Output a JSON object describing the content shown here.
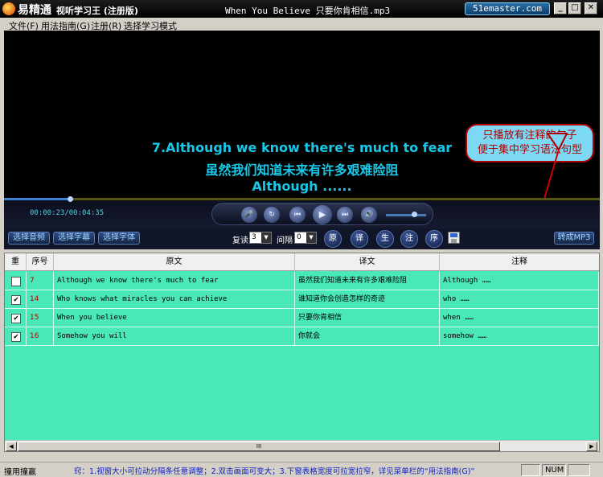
{
  "titlebar": {
    "app_name": "易精通",
    "app_subtitle": "视听学习王 (注册版)",
    "window_title": "When You Believe 只要你肯相信.mp3",
    "site_badge": "51emaster.com",
    "minimize": "_",
    "maximize": "□",
    "close": "✕"
  },
  "menu": {
    "items": [
      "文件(F)",
      "用法指南(G)",
      "注册(R)",
      "选择学习模式"
    ]
  },
  "video": {
    "subtitle_en": "7.Although we know there's much to fear",
    "subtitle_cn": "虽然我们知道未来有许多艰难险阻",
    "subtitle_note": "Although ......",
    "callout_line1": "只播放有注释的句子",
    "callout_line2": "便于集中学习语法句型"
  },
  "player": {
    "time": "00:00:23/00:04:35",
    "progress_fraction": 0.11,
    "volume_fraction": 0.7,
    "buttons": {
      "mic": "🎤",
      "repeat": "↻",
      "prev": "⏮",
      "play": "▶",
      "next": "⏭",
      "volume": "🔊"
    }
  },
  "toolbar": {
    "select_audio": "选择音频",
    "select_subtitle": "选择字幕",
    "select_font": "选择字体",
    "repeat_label": "复读",
    "repeat_value": "3",
    "interval_label": "间隔",
    "interval_value": "0",
    "btn_original": "原",
    "btn_translation": "译",
    "btn_new": "生",
    "btn_note": "注",
    "btn_order": "序",
    "convert_mp3": "转成MP3"
  },
  "table": {
    "headers": [
      "重",
      "序号",
      "原文",
      "译文",
      "注释"
    ],
    "rows": [
      {
        "checked": false,
        "index": "7",
        "original": "Although we know there's much to fear",
        "translation": "虽然我们知道未来有许多艰难险阻",
        "note": "Although ……"
      },
      {
        "checked": true,
        "index": "14",
        "original": "Who knows what miracles you can achieve",
        "translation": "谁知道你会创造怎样的奇迹",
        "note": "who ……"
      },
      {
        "checked": true,
        "index": "15",
        "original": "When you believe",
        "translation": "只要你肯相信",
        "note": "when ……"
      },
      {
        "checked": true,
        "index": "16",
        "original": "Somehow you will",
        "translation": "你就会",
        "note": "somehow ……"
      }
    ],
    "scroll_left": "◀",
    "scroll_right": "▶",
    "scroll_grip": "III"
  },
  "status": {
    "left": "撞用撞赢",
    "tip": "窍：1.视窗大小可拉动分隔条任意调整；2.双击画面可变大；3.下窗表格宽度可拉宽拉窄，详见菜单栏的“用法指南(G)”",
    "num": "NUM"
  }
}
